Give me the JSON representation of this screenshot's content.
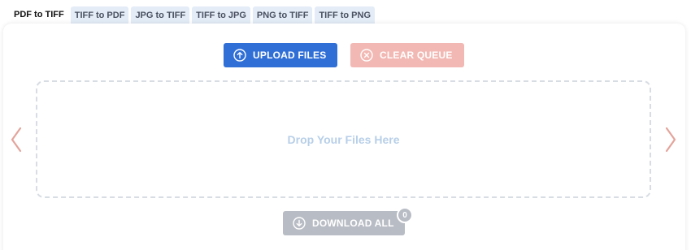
{
  "tabs": [
    {
      "label": "PDF to TIFF",
      "active": true
    },
    {
      "label": "TIFF to PDF",
      "active": false
    },
    {
      "label": "JPG to TIFF",
      "active": false
    },
    {
      "label": "TIFF to JPG",
      "active": false
    },
    {
      "label": "PNG to TIFF",
      "active": false
    },
    {
      "label": "TIFF to PNG",
      "active": false
    }
  ],
  "toolbar": {
    "upload_label": "UPLOAD FILES",
    "upload_icon": "arrow-up-circle-icon",
    "clear_label": "CLEAR QUEUE",
    "clear_icon": "x-circle-icon"
  },
  "dropzone": {
    "text": "Drop Your Files Here"
  },
  "download": {
    "label": "DOWNLOAD ALL",
    "icon": "arrow-down-circle-icon",
    "count": "0"
  },
  "nav": {
    "prev_icon": "chevron-left-icon",
    "next_icon": "chevron-right-icon"
  },
  "colors": {
    "upload": "#2f6fd6",
    "clear": "#f2b8b3",
    "download": "#b8bcc4",
    "arrows": "#e3a49c",
    "drop_text": "#b7cfe8",
    "tab_bg": "#e3ecf7"
  }
}
